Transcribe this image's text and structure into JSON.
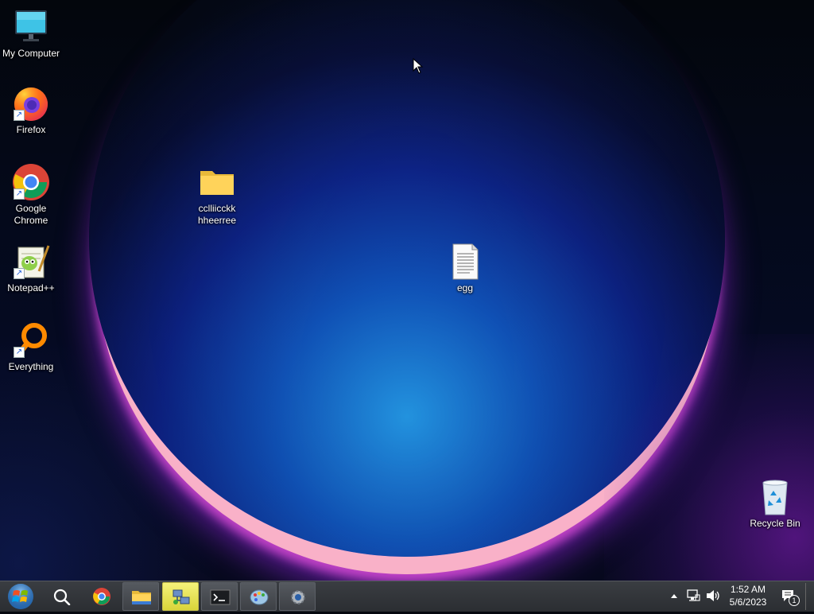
{
  "desktop": {
    "icons": [
      {
        "label": "My Computer",
        "icon": "computer-icon"
      },
      {
        "label": "Firefox",
        "icon": "firefox-icon"
      },
      {
        "label": "Google Chrome",
        "icon": "chrome-icon"
      },
      {
        "label": "Notepad++",
        "icon": "notepadpp-icon"
      },
      {
        "label": "Everything",
        "icon": "everything-icon"
      },
      {
        "label": "cclliicckk hheerree",
        "icon": "folder-icon"
      },
      {
        "label": "egg",
        "icon": "text-file-icon"
      },
      {
        "label": "Recycle Bin",
        "icon": "recycle-bin-icon"
      }
    ]
  },
  "taskbar": {
    "items": [
      {
        "name": "start-button",
        "icon": "windows-orb-icon"
      },
      {
        "name": "search",
        "icon": "search-icon"
      },
      {
        "name": "chrome",
        "icon": "chrome-icon"
      },
      {
        "name": "file-explorer",
        "icon": "folder-icon"
      },
      {
        "name": "network-tool",
        "icon": "network-app-icon",
        "active": true
      },
      {
        "name": "terminal",
        "icon": "terminal-icon"
      },
      {
        "name": "paint",
        "icon": "paint-icon"
      },
      {
        "name": "settings",
        "icon": "gear-icon"
      }
    ],
    "tray": {
      "icons": [
        "chevron-up-icon",
        "network-icon",
        "volume-icon"
      ],
      "time": "1:52 AM",
      "date": "5/6/2023",
      "notification_count": "1"
    }
  },
  "colors": {
    "taskbar": "#2b2e32",
    "active_taskbar_item": "#e8e35a",
    "wallpaper_glow": "#1e6ef0"
  }
}
